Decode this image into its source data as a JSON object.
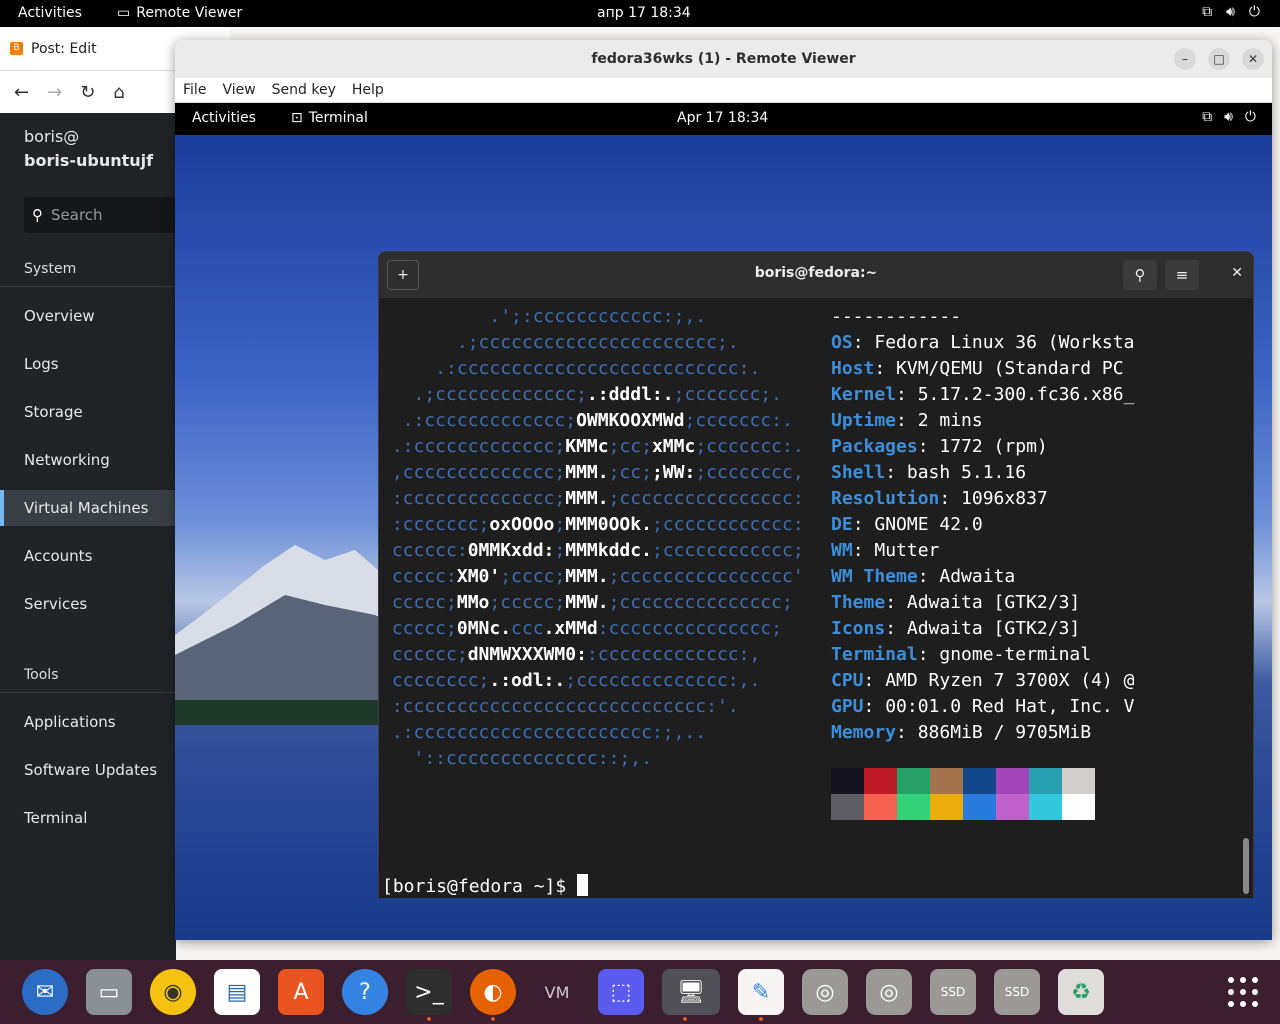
{
  "host_topbar": {
    "activities": "Activities",
    "app": "Remote Viewer",
    "clock": "апр 17  18:34"
  },
  "browser": {
    "tab_title": "Post: Edit"
  },
  "cockpit": {
    "user": "boris@",
    "host": "boris-ubuntujf",
    "search_placeholder": "Search",
    "section_system": "System",
    "items": [
      "Overview",
      "Logs",
      "Storage",
      "Networking",
      "Virtual Machines",
      "Accounts",
      "Services"
    ],
    "section_tools": "Tools",
    "tools": [
      "Applications",
      "Software Updates",
      "Terminal"
    ]
  },
  "remote_viewer": {
    "title": "fedora36wks (1) - Remote Viewer",
    "menu": [
      "File",
      "View",
      "Send key",
      "Help"
    ]
  },
  "guest_topbar": {
    "activities": "Activities",
    "app": "Terminal",
    "clock": "Apr 17  18:34"
  },
  "terminal": {
    "title": "boris@fedora:~",
    "separator": "------------",
    "info": [
      {
        "k": "OS",
        "v": ": Fedora Linux 36 (Worksta"
      },
      {
        "k": "Host",
        "v": ": KVM/QEMU (Standard PC"
      },
      {
        "k": "Kernel",
        "v": ": 5.17.2-300.fc36.x86_"
      },
      {
        "k": "Uptime",
        "v": ": 2 mins"
      },
      {
        "k": "Packages",
        "v": ": 1772 (rpm)"
      },
      {
        "k": "Shell",
        "v": ": bash 5.1.16"
      },
      {
        "k": "Resolution",
        "v": ": 1096x837"
      },
      {
        "k": "DE",
        "v": ": GNOME 42.0"
      },
      {
        "k": "WM",
        "v": ": Mutter"
      },
      {
        "k": "WM Theme",
        "v": ": Adwaita"
      },
      {
        "k": "Theme",
        "v": ": Adwaita [GTK2/3]"
      },
      {
        "k": "Icons",
        "v": ": Adwaita [GTK2/3]"
      },
      {
        "k": "Terminal",
        "v": ": gnome-terminal"
      },
      {
        "k": "CPU",
        "v": ": AMD Ryzen 7 3700X (4) @"
      },
      {
        "k": "GPU",
        "v": ": 00:01.0 Red Hat, Inc. V"
      },
      {
        "k": "Memory",
        "v": ": 886MiB / 9705MiB"
      }
    ],
    "palette": [
      "#171421",
      "#c01c28",
      "#26a269",
      "#a2734c",
      "#12488b",
      "#a347ba",
      "#2aa1b3",
      "#d0cfcc",
      "#5e5c64",
      "#f66151",
      "#33d17a",
      "#e9ad0c",
      "#2a7bde",
      "#c061cb",
      "#33c7de",
      "#ffffff"
    ],
    "prompt": "[boris@fedora ~]$ "
  },
  "dock": {
    "apps": [
      "thunderbird",
      "files",
      "rhythmbox",
      "writer",
      "app-center",
      "help",
      "terminal",
      "firefox",
      "virt-manager",
      "screenshot",
      "remote-viewer",
      "text-editor",
      "disc",
      "disc",
      "ssd",
      "ssd",
      "trash"
    ]
  }
}
